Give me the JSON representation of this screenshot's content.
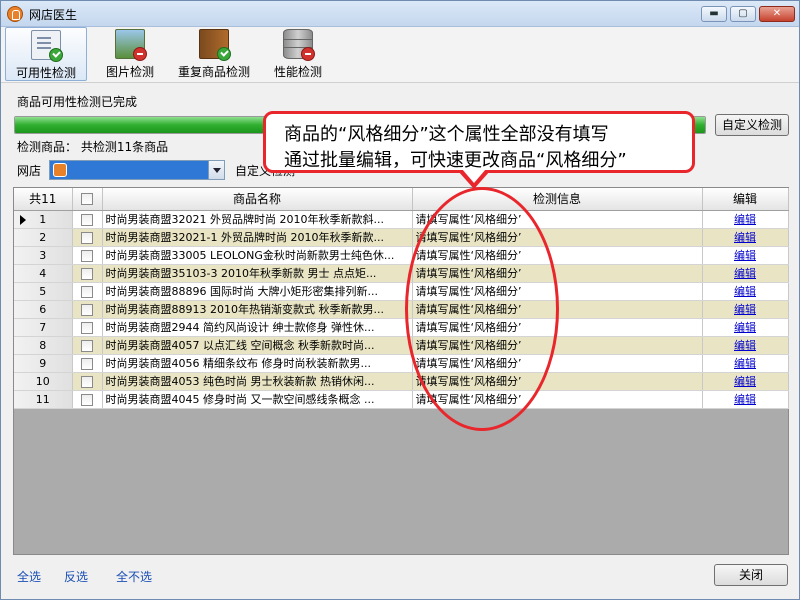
{
  "window": {
    "title": "网店医生",
    "min_glyph": "▬",
    "max_glyph": "▢",
    "close_glyph": "✕"
  },
  "toolbar": {
    "items": [
      {
        "label": "可用性检测",
        "active": true
      },
      {
        "label": "图片检测"
      },
      {
        "label": "重复商品检测"
      },
      {
        "label": "性能检测"
      }
    ]
  },
  "status": {
    "text": "商品可用性检测已完成",
    "progress_percent": 100
  },
  "buttons": {
    "custom_check": "自定义检测",
    "close": "关闭"
  },
  "summary": {
    "text": "检测商品： 共检测11条商品"
  },
  "shop": {
    "label": "网店"
  },
  "custom_partial": "自定义检测",
  "grid": {
    "headers": {
      "count": "共11",
      "name": "商品名称",
      "info": "检测信息",
      "edit": "编辑"
    },
    "edit_link": "编辑",
    "rows": [
      {
        "no": "1",
        "name": "时尚男装商盟32021 外贸品牌时尚 2010年秋季新款斜...",
        "info": "请填写属性‘风格细分’",
        "current": true
      },
      {
        "no": "2",
        "name": "时尚男装商盟32021-1 外贸品牌时尚 2010年秋季新款...",
        "info": "请填写属性‘风格细分’"
      },
      {
        "no": "3",
        "name": "时尚男装商盟33005 LEOLONG金秋时尚新款男士纯色休...",
        "info": "请填写属性‘风格细分’"
      },
      {
        "no": "4",
        "name": "时尚男装商盟35103-3 2010年秋季新款 男士 点点矩...",
        "info": "请填写属性‘风格细分’"
      },
      {
        "no": "5",
        "name": "时尚男装商盟88896 国际时尚 大牌小矩形密集排列新...",
        "info": "请填写属性‘风格细分’"
      },
      {
        "no": "6",
        "name": "时尚男装商盟88913 2010年热销渐变款式 秋季新款男...",
        "info": "请填写属性‘风格细分’"
      },
      {
        "no": "7",
        "name": "时尚男装商盟2944 简约风尚设计 绅士款修身 弹性休...",
        "info": "请填写属性‘风格细分’"
      },
      {
        "no": "8",
        "name": "时尚男装商盟4057 以点汇线 空间概念 秋季新款时尚...",
        "info": "请填写属性‘风格细分’"
      },
      {
        "no": "9",
        "name": "时尚男装商盟4056 精细条纹布 修身时尚秋装新款男...",
        "info": "请填写属性‘风格细分’"
      },
      {
        "no": "10",
        "name": "时尚男装商盟4053 纯色时尚 男士秋装新款 热销休闲...",
        "info": "请填写属性‘风格细分’"
      },
      {
        "no": "11",
        "name": "时尚男装商盟4045 修身时尚 又一款空间感线条概念 ...",
        "info": "请填写属性‘风格细分’"
      }
    ]
  },
  "footer": {
    "select_all": "全选",
    "invert": "反选",
    "select_none": "全不选"
  },
  "callout": {
    "line1": "商品的“风格细分”这个属性全部没有填写",
    "line2": "通过批量编辑，可快速更改商品“风格细分”"
  },
  "colors": {
    "accent_red": "#e8262b",
    "progress_green": "#2fae2f",
    "link_blue": "#1a4fb5"
  }
}
